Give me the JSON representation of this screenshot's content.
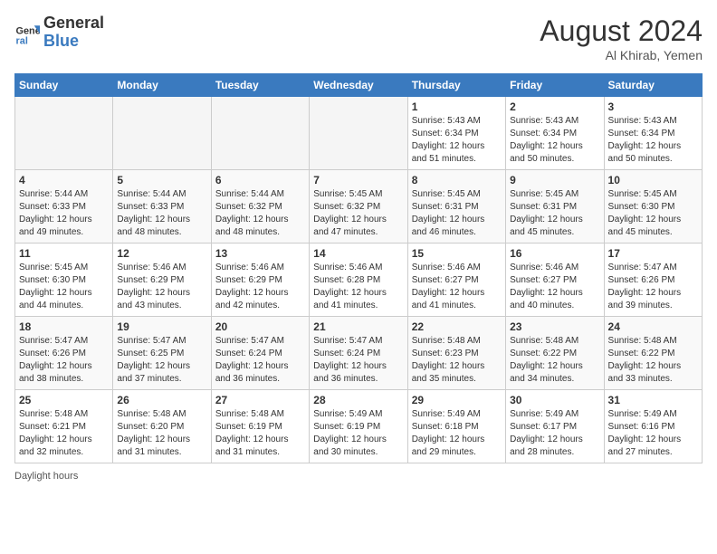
{
  "header": {
    "logo_line1": "General",
    "logo_line2": "Blue",
    "month_year": "August 2024",
    "location": "Al Khirab, Yemen"
  },
  "days_of_week": [
    "Sunday",
    "Monday",
    "Tuesday",
    "Wednesday",
    "Thursday",
    "Friday",
    "Saturday"
  ],
  "weeks": [
    [
      {
        "day": "",
        "empty": true
      },
      {
        "day": "",
        "empty": true
      },
      {
        "day": "",
        "empty": true
      },
      {
        "day": "",
        "empty": true
      },
      {
        "day": "1",
        "sunrise": "Sunrise: 5:43 AM",
        "sunset": "Sunset: 6:34 PM",
        "daylight": "Daylight: 12 hours and 51 minutes."
      },
      {
        "day": "2",
        "sunrise": "Sunrise: 5:43 AM",
        "sunset": "Sunset: 6:34 PM",
        "daylight": "Daylight: 12 hours and 50 minutes."
      },
      {
        "day": "3",
        "sunrise": "Sunrise: 5:43 AM",
        "sunset": "Sunset: 6:34 PM",
        "daylight": "Daylight: 12 hours and 50 minutes."
      }
    ],
    [
      {
        "day": "4",
        "sunrise": "Sunrise: 5:44 AM",
        "sunset": "Sunset: 6:33 PM",
        "daylight": "Daylight: 12 hours and 49 minutes."
      },
      {
        "day": "5",
        "sunrise": "Sunrise: 5:44 AM",
        "sunset": "Sunset: 6:33 PM",
        "daylight": "Daylight: 12 hours and 48 minutes."
      },
      {
        "day": "6",
        "sunrise": "Sunrise: 5:44 AM",
        "sunset": "Sunset: 6:32 PM",
        "daylight": "Daylight: 12 hours and 48 minutes."
      },
      {
        "day": "7",
        "sunrise": "Sunrise: 5:45 AM",
        "sunset": "Sunset: 6:32 PM",
        "daylight": "Daylight: 12 hours and 47 minutes."
      },
      {
        "day": "8",
        "sunrise": "Sunrise: 5:45 AM",
        "sunset": "Sunset: 6:31 PM",
        "daylight": "Daylight: 12 hours and 46 minutes."
      },
      {
        "day": "9",
        "sunrise": "Sunrise: 5:45 AM",
        "sunset": "Sunset: 6:31 PM",
        "daylight": "Daylight: 12 hours and 45 minutes."
      },
      {
        "day": "10",
        "sunrise": "Sunrise: 5:45 AM",
        "sunset": "Sunset: 6:30 PM",
        "daylight": "Daylight: 12 hours and 45 minutes."
      }
    ],
    [
      {
        "day": "11",
        "sunrise": "Sunrise: 5:45 AM",
        "sunset": "Sunset: 6:30 PM",
        "daylight": "Daylight: 12 hours and 44 minutes."
      },
      {
        "day": "12",
        "sunrise": "Sunrise: 5:46 AM",
        "sunset": "Sunset: 6:29 PM",
        "daylight": "Daylight: 12 hours and 43 minutes."
      },
      {
        "day": "13",
        "sunrise": "Sunrise: 5:46 AM",
        "sunset": "Sunset: 6:29 PM",
        "daylight": "Daylight: 12 hours and 42 minutes."
      },
      {
        "day": "14",
        "sunrise": "Sunrise: 5:46 AM",
        "sunset": "Sunset: 6:28 PM",
        "daylight": "Daylight: 12 hours and 41 minutes."
      },
      {
        "day": "15",
        "sunrise": "Sunrise: 5:46 AM",
        "sunset": "Sunset: 6:27 PM",
        "daylight": "Daylight: 12 hours and 41 minutes."
      },
      {
        "day": "16",
        "sunrise": "Sunrise: 5:46 AM",
        "sunset": "Sunset: 6:27 PM",
        "daylight": "Daylight: 12 hours and 40 minutes."
      },
      {
        "day": "17",
        "sunrise": "Sunrise: 5:47 AM",
        "sunset": "Sunset: 6:26 PM",
        "daylight": "Daylight: 12 hours and 39 minutes."
      }
    ],
    [
      {
        "day": "18",
        "sunrise": "Sunrise: 5:47 AM",
        "sunset": "Sunset: 6:26 PM",
        "daylight": "Daylight: 12 hours and 38 minutes."
      },
      {
        "day": "19",
        "sunrise": "Sunrise: 5:47 AM",
        "sunset": "Sunset: 6:25 PM",
        "daylight": "Daylight: 12 hours and 37 minutes."
      },
      {
        "day": "20",
        "sunrise": "Sunrise: 5:47 AM",
        "sunset": "Sunset: 6:24 PM",
        "daylight": "Daylight: 12 hours and 36 minutes."
      },
      {
        "day": "21",
        "sunrise": "Sunrise: 5:47 AM",
        "sunset": "Sunset: 6:24 PM",
        "daylight": "Daylight: 12 hours and 36 minutes."
      },
      {
        "day": "22",
        "sunrise": "Sunrise: 5:48 AM",
        "sunset": "Sunset: 6:23 PM",
        "daylight": "Daylight: 12 hours and 35 minutes."
      },
      {
        "day": "23",
        "sunrise": "Sunrise: 5:48 AM",
        "sunset": "Sunset: 6:22 PM",
        "daylight": "Daylight: 12 hours and 34 minutes."
      },
      {
        "day": "24",
        "sunrise": "Sunrise: 5:48 AM",
        "sunset": "Sunset: 6:22 PM",
        "daylight": "Daylight: 12 hours and 33 minutes."
      }
    ],
    [
      {
        "day": "25",
        "sunrise": "Sunrise: 5:48 AM",
        "sunset": "Sunset: 6:21 PM",
        "daylight": "Daylight: 12 hours and 32 minutes."
      },
      {
        "day": "26",
        "sunrise": "Sunrise: 5:48 AM",
        "sunset": "Sunset: 6:20 PM",
        "daylight": "Daylight: 12 hours and 31 minutes."
      },
      {
        "day": "27",
        "sunrise": "Sunrise: 5:48 AM",
        "sunset": "Sunset: 6:19 PM",
        "daylight": "Daylight: 12 hours and 31 minutes."
      },
      {
        "day": "28",
        "sunrise": "Sunrise: 5:49 AM",
        "sunset": "Sunset: 6:19 PM",
        "daylight": "Daylight: 12 hours and 30 minutes."
      },
      {
        "day": "29",
        "sunrise": "Sunrise: 5:49 AM",
        "sunset": "Sunset: 6:18 PM",
        "daylight": "Daylight: 12 hours and 29 minutes."
      },
      {
        "day": "30",
        "sunrise": "Sunrise: 5:49 AM",
        "sunset": "Sunset: 6:17 PM",
        "daylight": "Daylight: 12 hours and 28 minutes."
      },
      {
        "day": "31",
        "sunrise": "Sunrise: 5:49 AM",
        "sunset": "Sunset: 6:16 PM",
        "daylight": "Daylight: 12 hours and 27 minutes."
      }
    ]
  ],
  "footer": {
    "daylight_label": "Daylight hours"
  }
}
